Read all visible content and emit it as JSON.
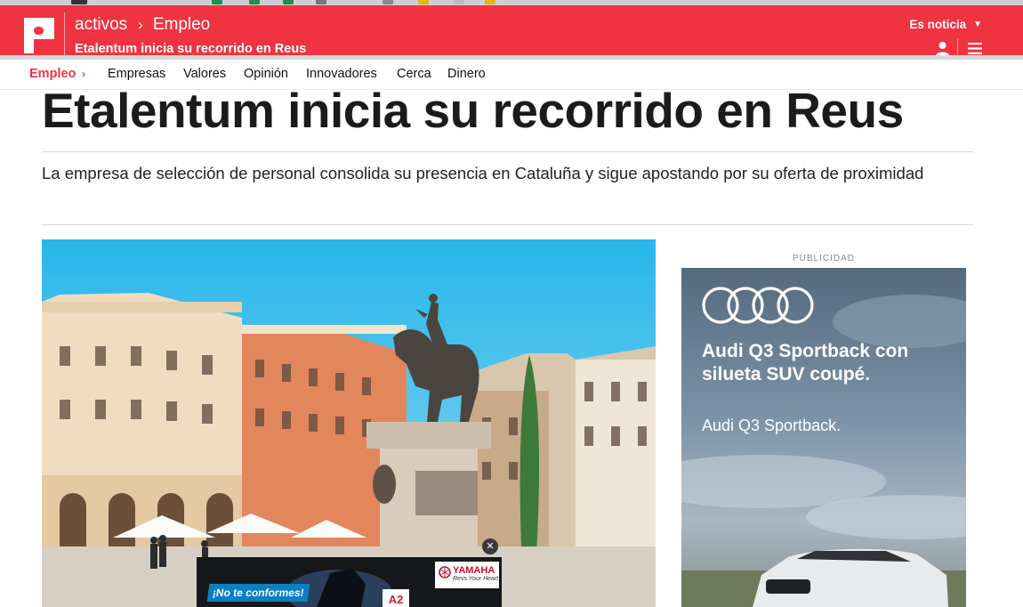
{
  "header": {
    "breadcrumb": {
      "section": "activos",
      "subsection": "Empleo"
    },
    "subtitle": "Etalentum inicia su recorrido en Reus",
    "dropdown_label": "Es noticia"
  },
  "secondary_nav": {
    "active": "Empleo",
    "items": [
      "Empresas",
      "Valores",
      "Opinión",
      "Innovadores",
      "Cerca",
      "Dinero"
    ]
  },
  "article": {
    "headline": "Etalentum inicia su recorrido en Reus",
    "lede": "La empresa de selección de personal consolida su presencia en Cataluña y sigue apostando por su oferta de proximidad"
  },
  "sidebar_ad": {
    "label": "PUBLICIDAD",
    "title": "Audi Q3 Sportback con silueta SUV coupé.",
    "subtitle": "Audi Q3 Sportback."
  },
  "floating_ad": {
    "tagline": "¡No te conformes!",
    "brand": "YAMAHA",
    "brand_tagline": "Revs Your Heart",
    "license_badge": "A2",
    "close_symbol": "✕"
  },
  "icons": {
    "crumb_separator": "chevron-right-icon",
    "dropdown": "chevron-down-icon",
    "user": "user-icon",
    "menu": "hamburger-menu-icon"
  },
  "colors": {
    "brand_red": "#ef3340",
    "text": "#1b1b1b"
  }
}
